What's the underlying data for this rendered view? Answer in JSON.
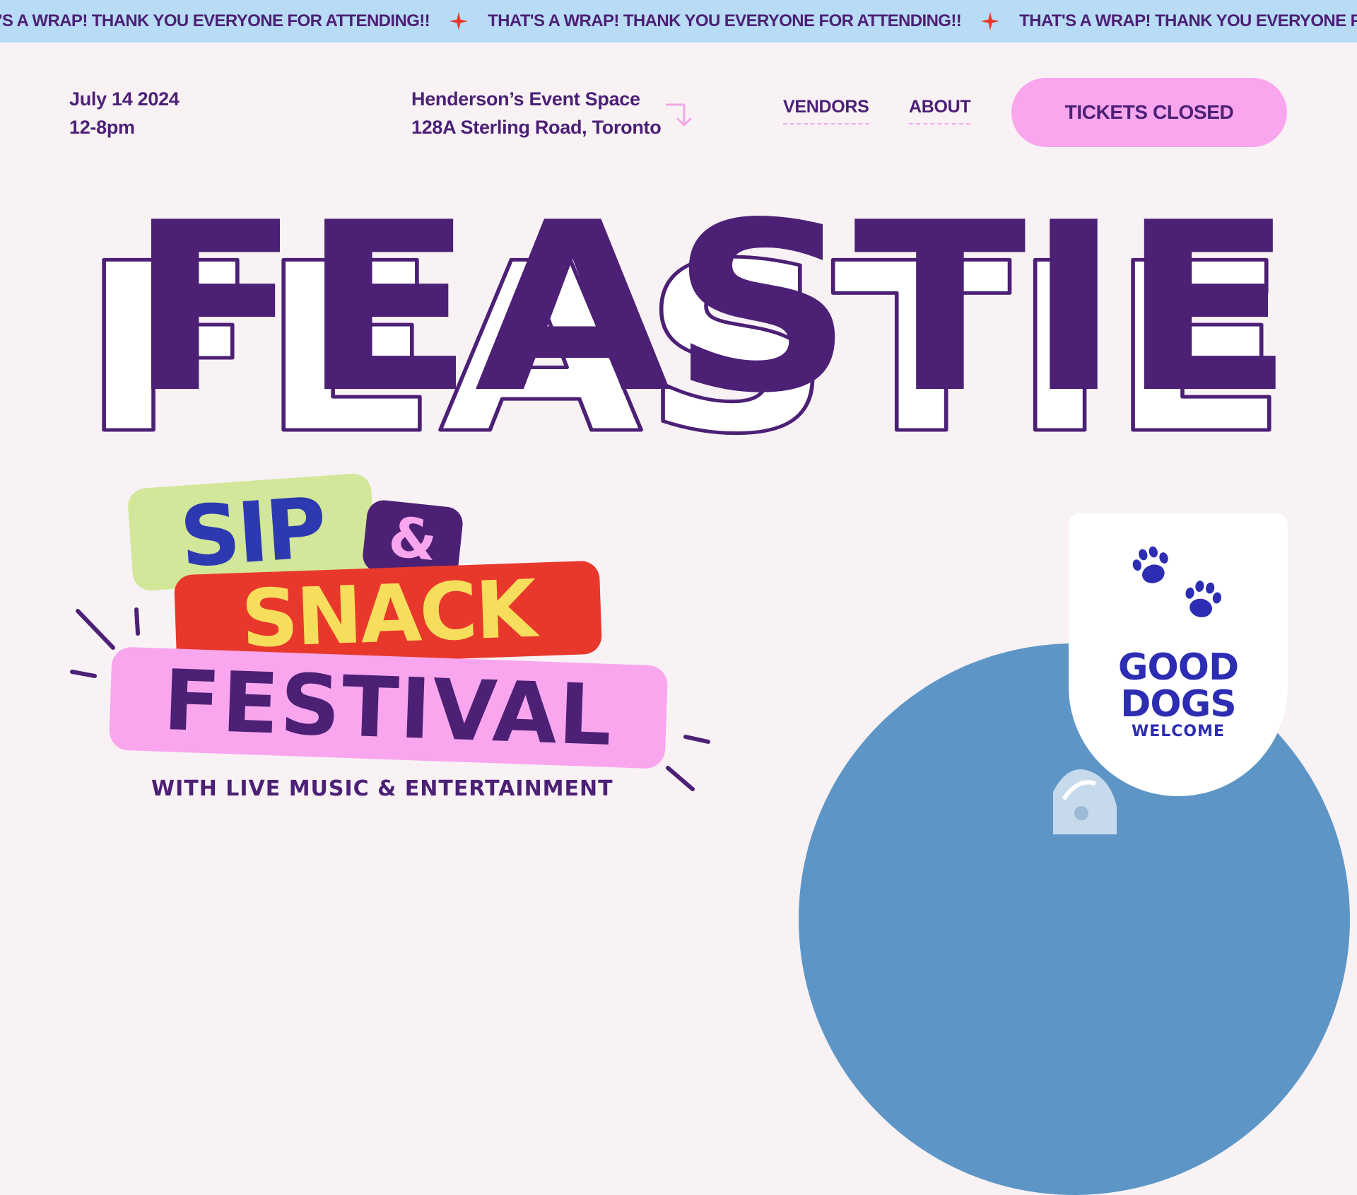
{
  "banner": {
    "text": "THAT'S A WRAP! THANK YOU EVERYONE FOR ATTENDING!!",
    "separator_icon": "sparkle-star-icon",
    "color": "#b8dcf6"
  },
  "event": {
    "date": "July 14 2024",
    "time": "12-8pm",
    "venue": "Henderson’s Event Space",
    "address": "128A Sterling Road, Toronto"
  },
  "nav": {
    "vendors": "VENDORS",
    "about": "ABOUT",
    "tickets": "TICKETS CLOSED"
  },
  "hero": {
    "title": "FEASTIE"
  },
  "festival_badge": {
    "sip": "SIP",
    "amp": "&",
    "snack": "SNACK",
    "festival": "FESTIVAL",
    "tagline": "WITH LIVE MUSIC & ENTERTAINMENT"
  },
  "dogs_card": {
    "line1": "GOOD",
    "line2": "DOGS",
    "line3": "WELCOME",
    "icon": "paw-print-icon"
  },
  "colors": {
    "purple": "#4c2075",
    "pink": "#f9a6ee",
    "red": "#e8382c",
    "yellow": "#f6dd5b",
    "lime": "#d3e79a",
    "blue": "#2d39b0",
    "sky": "#5d96c6"
  }
}
